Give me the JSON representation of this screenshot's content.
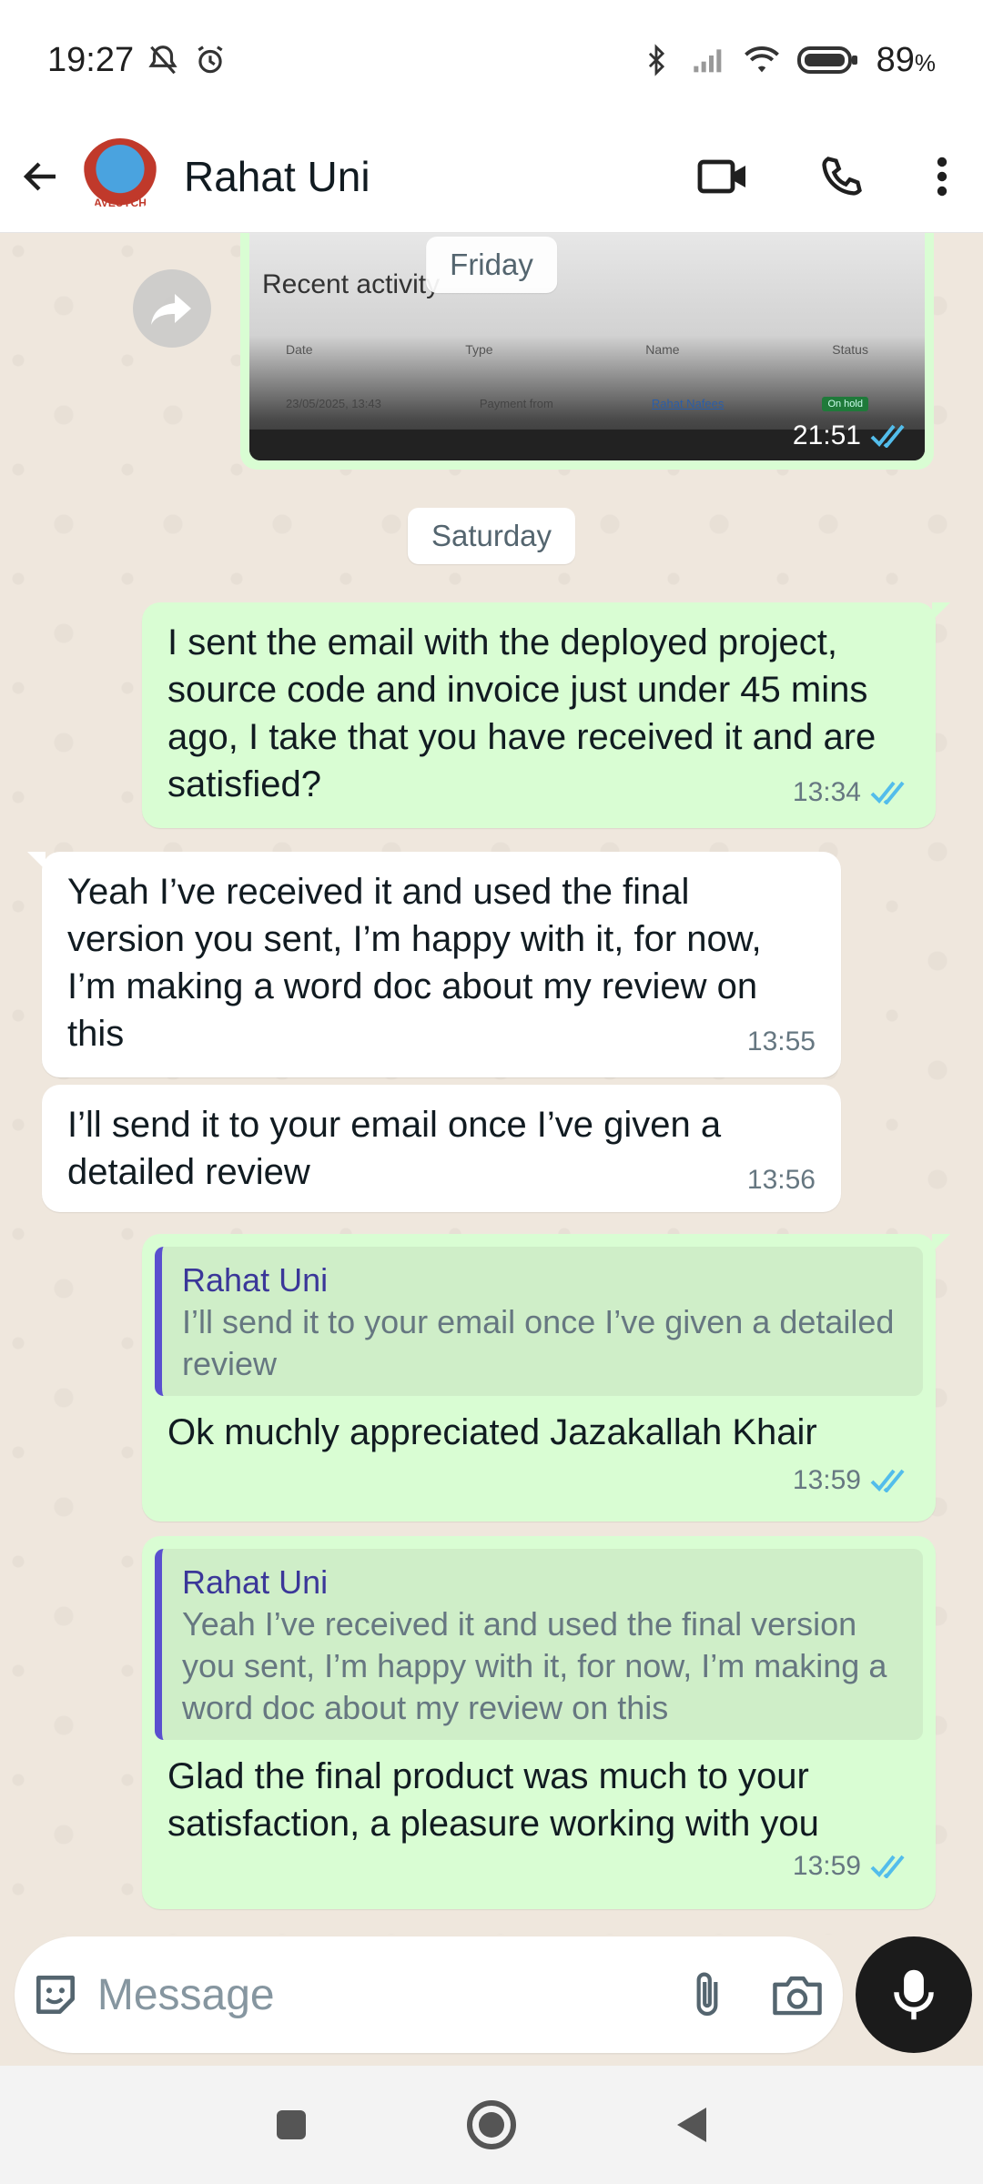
{
  "status_bar": {
    "time": "19:27",
    "battery": "89",
    "battery_unit": "%"
  },
  "header": {
    "contact_name": "Rahat Uni",
    "avatar_text": "AVEUYCH"
  },
  "image_message": {
    "title": "Recent activity",
    "columns": [
      "Date",
      "Type",
      "Name",
      "Status"
    ],
    "row": [
      "23/05/2025, 13:43",
      "Payment from",
      "Rahat Nafees",
      "On hold"
    ],
    "time": "21:51"
  },
  "date_chips": {
    "friday": "Friday",
    "saturday": "Saturday"
  },
  "messages": [
    {
      "text": "I sent the email with the deployed project, source code and invoice just under 45 mins ago, I take that you have received it and are satisfied?",
      "time": "13:34"
    },
    {
      "text": "Yeah I’ve received it and used the final version you sent, I’m happy with it, for now, I’m making a word doc about my review on this",
      "time": "13:55"
    },
    {
      "text": "I’ll send it to your email once I’ve given a detailed review",
      "time": "13:56"
    },
    {
      "quote_author": "Rahat Uni",
      "quote_text": "I’ll send it to your email once I’ve given a detailed review",
      "text": "Ok muchly appreciated Jazakallah Khair",
      "time": "13:59"
    },
    {
      "quote_author": "Rahat Uni",
      "quote_text": "Yeah I’ve received it and used the final version you sent, I’m happy with it, for now, I’m making a word doc about my review on this",
      "text": "Glad the final product was much to your satisfaction, a pleasure working with you",
      "time": "13:59"
    }
  ],
  "composer": {
    "placeholder": "Message"
  },
  "colors": {
    "outgoing_bubble": "#d9fdd3",
    "incoming_bubble": "#ffffff",
    "read_ticks": "#53bdeb",
    "quote_bar": "#5a4fcf"
  }
}
